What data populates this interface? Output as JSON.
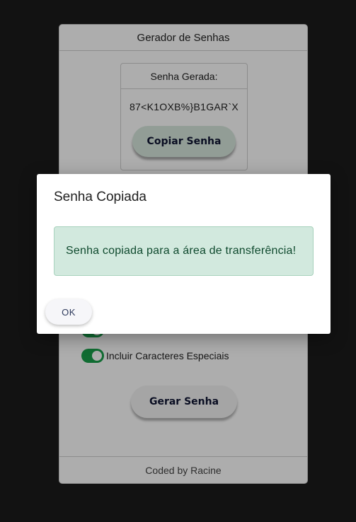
{
  "app": {
    "title": "Gerador de Senhas",
    "result_heading": "Senha Gerada:",
    "password": "87<K1OXB%}B1GAR`X",
    "copy_button": "Copiar Senha",
    "options": [
      {
        "label": "",
        "enabled": true
      },
      {
        "label": "Incluir Caracteres Especiais",
        "enabled": true
      }
    ],
    "generate_button": "Gerar Senha",
    "footer": "Coded by Racine"
  },
  "dialog": {
    "title": "Senha Copiada",
    "message": "Senha copiada para a área de transferência!",
    "ok_button": "OK"
  },
  "colors": {
    "accent_toggle": "#19a04a",
    "alert_background": "#d2e9de",
    "alert_text": "#0f4a2e",
    "button_text": "#0f1533"
  }
}
